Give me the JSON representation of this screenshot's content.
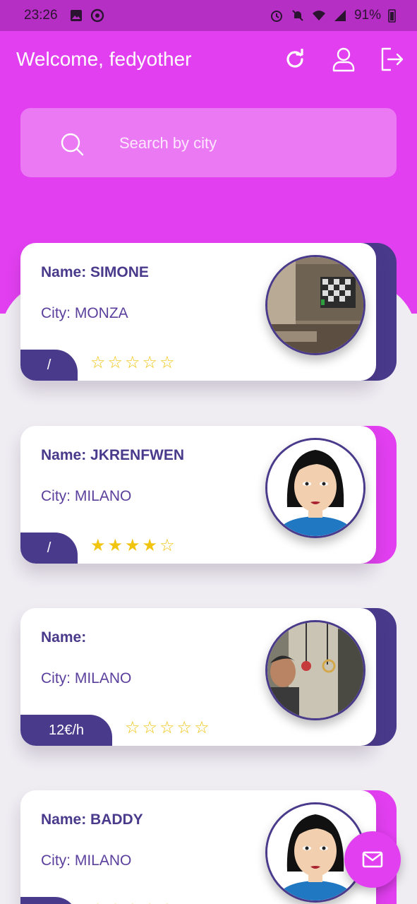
{
  "status_bar": {
    "time": "23:26",
    "battery": "91%"
  },
  "header": {
    "welcome": "Welcome, fedyother"
  },
  "search": {
    "placeholder": "Search by city",
    "value": ""
  },
  "cards": [
    {
      "name": "Name: SIMONE",
      "city": "City: MONZA",
      "price": "/",
      "rating": 0,
      "accent": "#4a3a8c",
      "avatar": "room-photo"
    },
    {
      "name": "Name: JKRENFWEN",
      "city": "City: MILANO",
      "price": "/",
      "rating": 4,
      "accent": "#e23ff0",
      "avatar": "cartoon-woman"
    },
    {
      "name": "Name:",
      "city": "City: MILANO",
      "price": "12€/h",
      "rating": 0,
      "accent": "#4a3a8c",
      "avatar": "gym-photo"
    },
    {
      "name": "Name: BADDY",
      "city": "City: MILANO",
      "price": "",
      "rating": 0,
      "accent": "#e23ff0",
      "avatar": "cartoon-woman"
    }
  ],
  "icons": {
    "refresh": "refresh-icon",
    "profile": "user-icon",
    "logout": "logout-icon",
    "search": "search-icon",
    "fab": "mail-icon"
  },
  "colors": {
    "primary": "#e23ff0",
    "secondary": "#4a3a8c",
    "star": "#f1c40f"
  }
}
